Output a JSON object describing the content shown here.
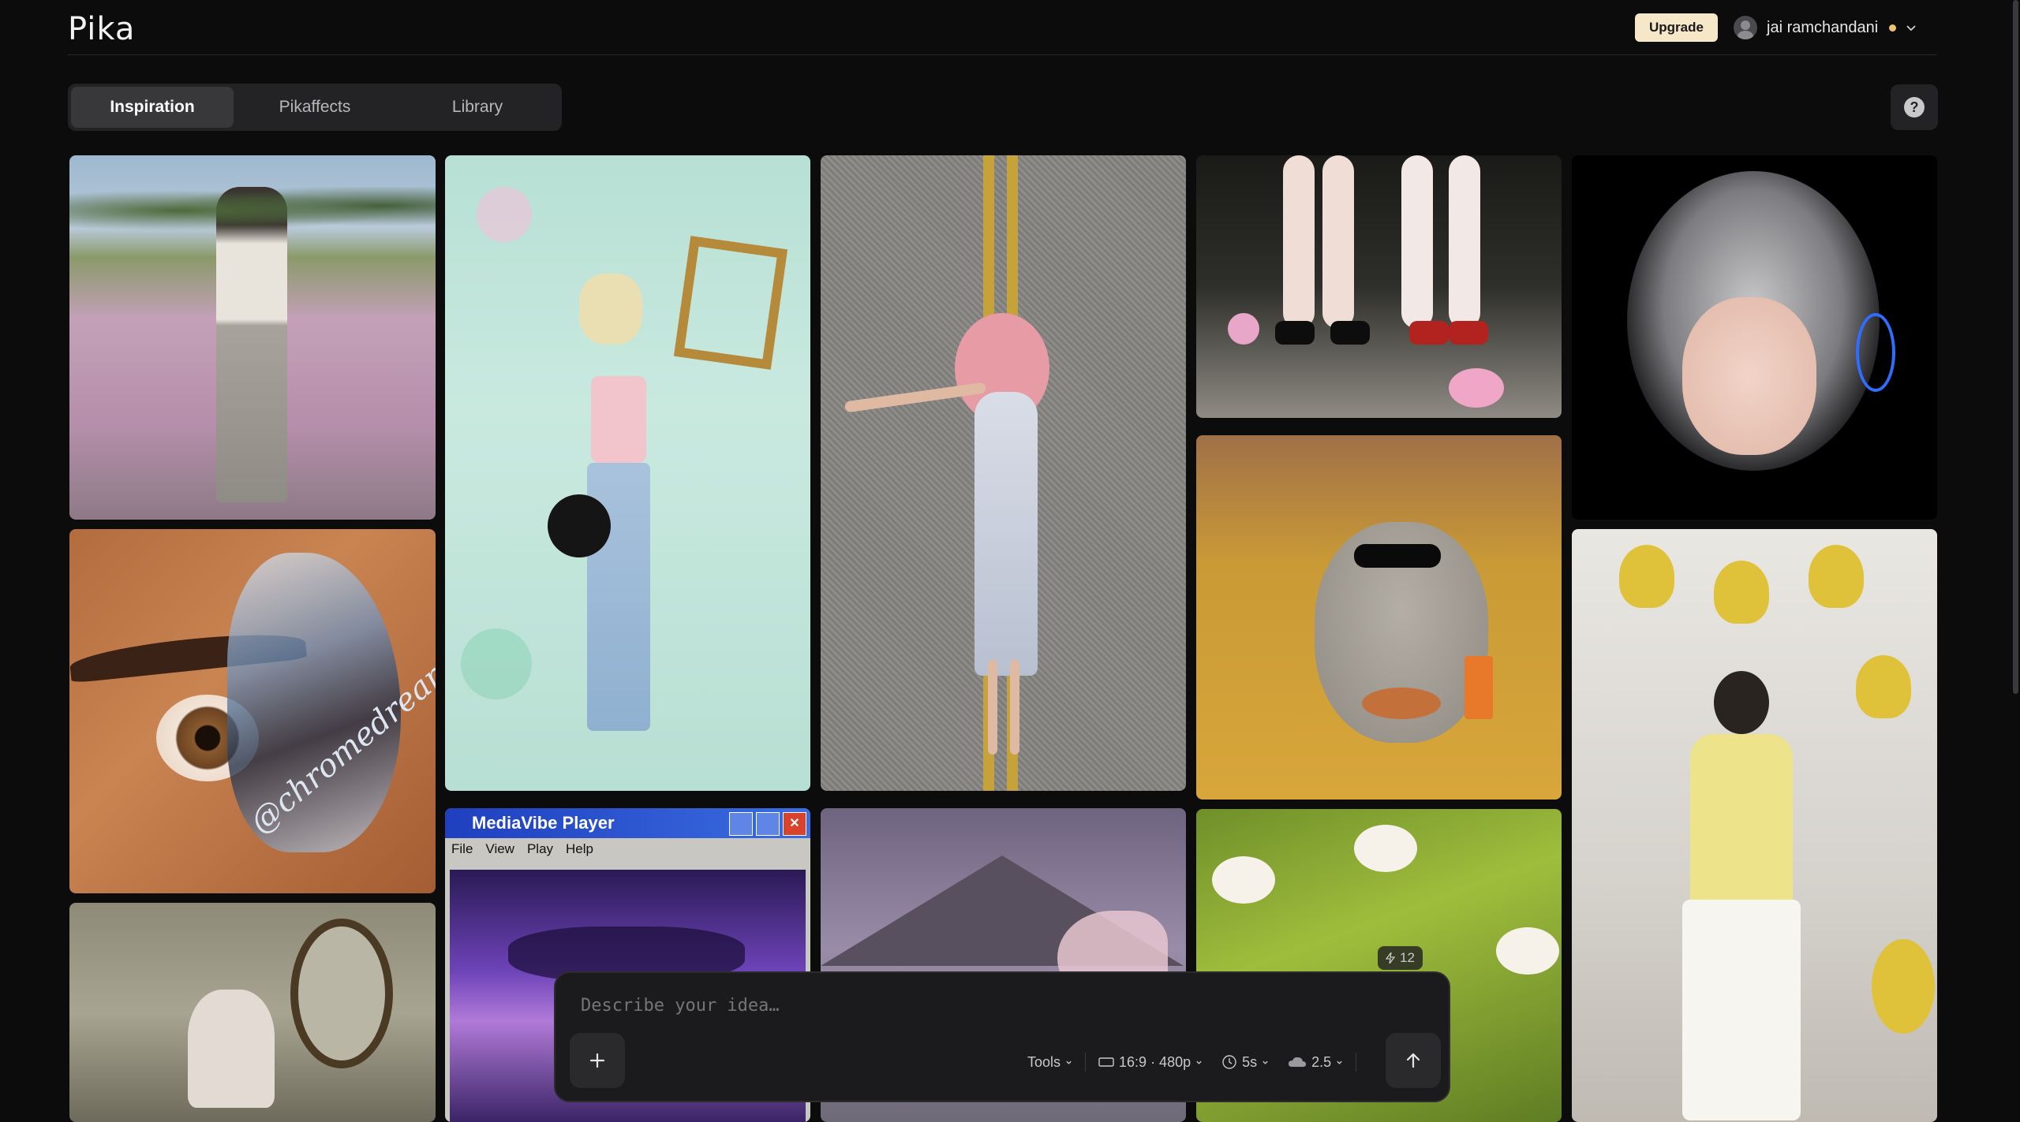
{
  "app": {
    "name": "Pika"
  },
  "header": {
    "upgrade_label": "Upgrade",
    "user_name": "jai ramchandani"
  },
  "tabs": [
    {
      "label": "Inspiration",
      "active": true
    },
    {
      "label": "Pikaffects",
      "active": false
    },
    {
      "label": "Library",
      "active": false
    }
  ],
  "help_icon": "question-icon",
  "gallery": {
    "mediaplayer_card": {
      "title": "MediaVibe Player",
      "menu": [
        "File",
        "View",
        "Play",
        "Help"
      ]
    },
    "chrome_card_text": "@chromedream",
    "like_count": "12"
  },
  "prompt": {
    "placeholder": "Describe your idea…",
    "tools_label": "Tools",
    "aspect_label": "16:9 · 480p",
    "duration_label": "5s",
    "model_label": "2.5",
    "icons": {
      "add": "plus-icon",
      "send": "arrow-up-icon",
      "aspect": "aspect-ratio-icon",
      "duration": "clock-icon",
      "model": "cloud-icon"
    }
  },
  "colors": {
    "background": "#0c0c0d",
    "upgrade": "#f7e7c9",
    "panel": "#1b1b1d",
    "status_dot": "#f0c36b"
  }
}
